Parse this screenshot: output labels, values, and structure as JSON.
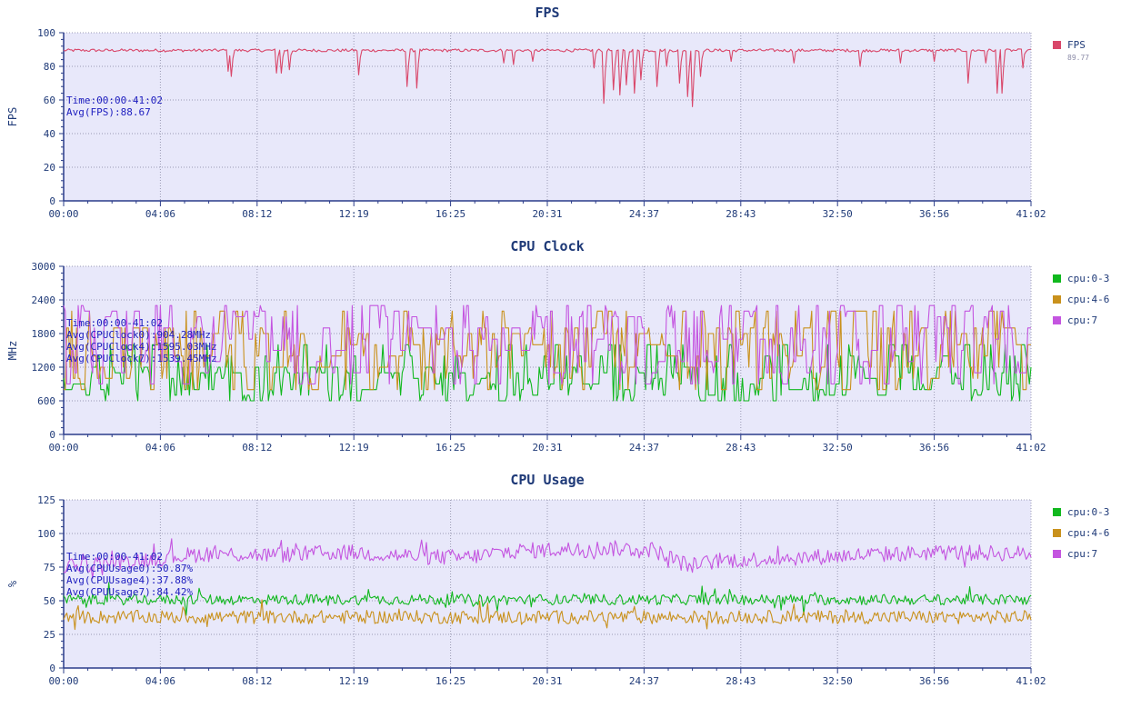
{
  "time_ticks": [
    "00:00",
    "04:06",
    "08:12",
    "12:19",
    "16:25",
    "20:31",
    "24:37",
    "28:43",
    "32:50",
    "36:56",
    "41:02"
  ],
  "chart_data": [
    {
      "type": "line",
      "title": "FPS",
      "ylabel": "FPS",
      "ylim": [
        0,
        100
      ],
      "yticks": [
        0,
        20,
        40,
        60,
        80,
        100
      ],
      "xlim_minutes": [
        0,
        41.033
      ],
      "grid": true,
      "legend_position": "right",
      "annotation": [
        "Time:00:00-41:02",
        "Avg(FPS):88.67"
      ],
      "series": [
        {
          "name": "FPS",
          "legend_value": "89.77",
          "color": "#d9476a",
          "baseline": 89.5,
          "noise": 0.9,
          "dips": [
            [
              7.0,
              77
            ],
            [
              7.1,
              74
            ],
            [
              9.0,
              76
            ],
            [
              9.2,
              76
            ],
            [
              9.6,
              78
            ],
            [
              12.5,
              75
            ],
            [
              14.6,
              68
            ],
            [
              15.0,
              67
            ],
            [
              18.7,
              82
            ],
            [
              19.1,
              81
            ],
            [
              19.9,
              83
            ],
            [
              22.5,
              79
            ],
            [
              22.9,
              58
            ],
            [
              23.3,
              66
            ],
            [
              23.6,
              63
            ],
            [
              23.9,
              69
            ],
            [
              24.2,
              64
            ],
            [
              24.5,
              72
            ],
            [
              25.2,
              68
            ],
            [
              25.6,
              80
            ],
            [
              26.1,
              70
            ],
            [
              26.5,
              62
            ],
            [
              26.7,
              56
            ],
            [
              27.0,
              74
            ],
            [
              28.3,
              83
            ],
            [
              31.0,
              82
            ],
            [
              33.8,
              80
            ],
            [
              35.5,
              82
            ],
            [
              36.9,
              83
            ],
            [
              38.4,
              70
            ],
            [
              39.1,
              82
            ],
            [
              39.6,
              64
            ],
            [
              39.8,
              64
            ],
            [
              40.7,
              79
            ]
          ]
        }
      ]
    },
    {
      "type": "line",
      "title": "CPU Clock",
      "ylabel": "MHz",
      "ylim": [
        0,
        3000
      ],
      "yticks": [
        0,
        600,
        1200,
        1800,
        2400,
        3000
      ],
      "xlim_minutes": [
        0,
        41.033
      ],
      "grid": true,
      "legend_position": "right",
      "annotation": [
        "Time:00:00-41:02",
        "Avg(CPUClock0):904.28MHz",
        "Avg(CPUClock4):1595.03MHz",
        "Avg(CPUClock7):1539.45MHz"
      ],
      "series": [
        {
          "name": "cpu:0-3",
          "color": "#10b81e",
          "avg": 904.28,
          "levels": [
            600,
            700,
            800,
            900,
            1000,
            1100,
            1200,
            1400,
            1600
          ]
        },
        {
          "name": "cpu:4-6",
          "color": "#c9911c",
          "avg": 1595.03,
          "levels": [
            800,
            1000,
            1200,
            1400,
            1600,
            1800,
            1900,
            2200
          ]
        },
        {
          "name": "cpu:7",
          "color": "#c455e0",
          "avg": 1539.45,
          "levels": [
            900,
            1100,
            1300,
            1500,
            1700,
            1900,
            2100,
            2200,
            2300
          ]
        }
      ]
    },
    {
      "type": "line",
      "title": "CPU Usage",
      "ylabel": "%",
      "ylim": [
        0,
        125
      ],
      "yticks": [
        0,
        25,
        50,
        75,
        100,
        125
      ],
      "xlim_minutes": [
        0,
        41.033
      ],
      "grid": true,
      "legend_position": "right",
      "annotation": [
        "Time:00:00-41:02",
        "Avg(CPUUsage0):50.87%",
        "Avg(CPUUsage4):37.88%",
        "Avg(CPUUsage7):84.42%"
      ],
      "series": [
        {
          "name": "cpu:0-3",
          "color": "#10b81e",
          "avg": 50.87,
          "spread": 4
        },
        {
          "name": "cpu:4-6",
          "color": "#c9911c",
          "avg": 37.88,
          "spread": 5
        },
        {
          "name": "cpu:7",
          "color": "#c455e0",
          "avg": 84.42,
          "spread": 6,
          "trend": [
            [
              0,
              76
            ],
            [
              3,
              80
            ],
            [
              6,
              85
            ],
            [
              9,
              84
            ],
            [
              12,
              86
            ],
            [
              15,
              83
            ],
            [
              17,
              82
            ],
            [
              19,
              87
            ],
            [
              21,
              88
            ],
            [
              23,
              89
            ],
            [
              25,
              88
            ],
            [
              26.5,
              76
            ],
            [
              28,
              80
            ],
            [
              31,
              82
            ],
            [
              34,
              84
            ],
            [
              37,
              86
            ],
            [
              41,
              85
            ]
          ]
        }
      ]
    }
  ]
}
